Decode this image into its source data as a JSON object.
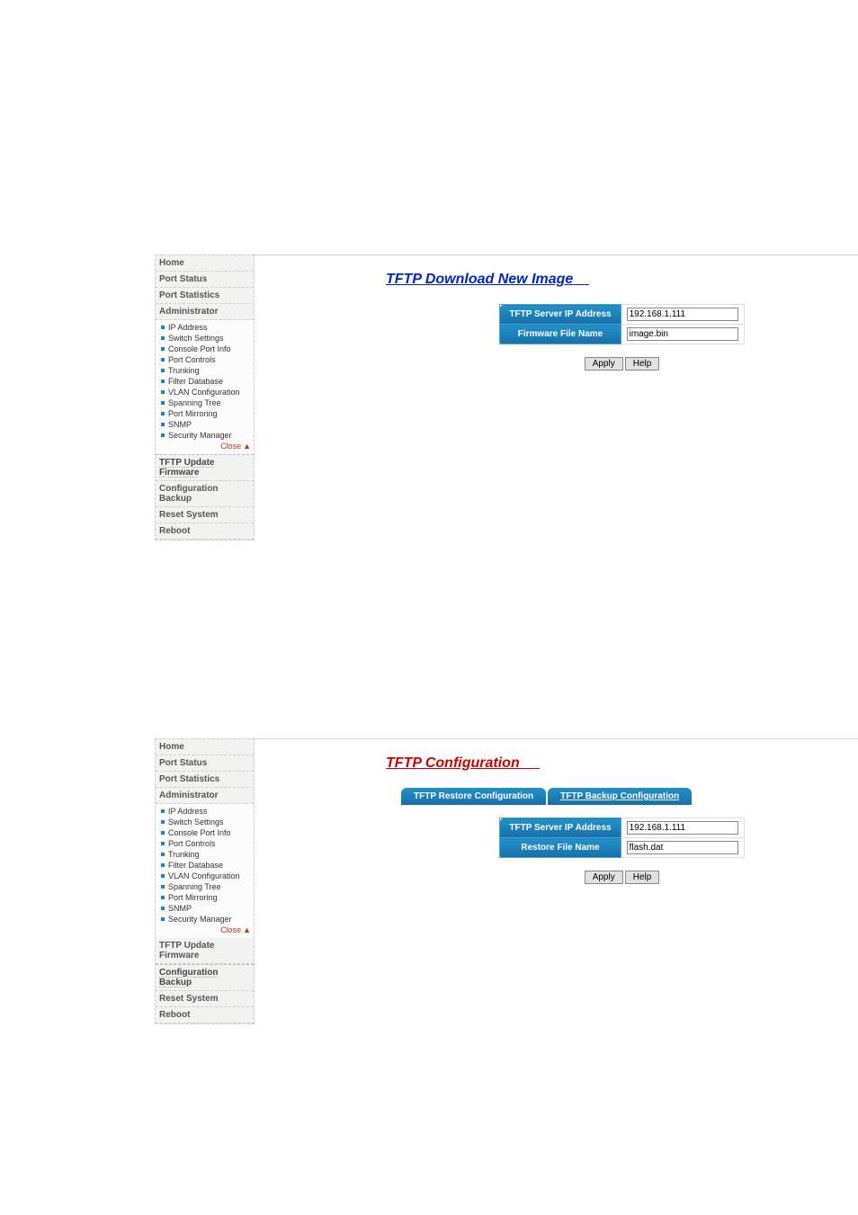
{
  "sidebar": {
    "home": "Home",
    "port_status": "Port Status",
    "port_statistics": "Port Statistics",
    "administrator": "Administrator",
    "admin_items": [
      "IP Address",
      "Switch Settings",
      "Console Port Info",
      "Port Controls",
      "Trunking",
      "Filter Database",
      "VLAN Configuration",
      "Spanning Tree",
      "Port Mirroring",
      "SNMP",
      "Security Manager"
    ],
    "close": "Close",
    "tftp_update": "TFTP Update Firmware",
    "config_backup": "Configuration Backup",
    "reset_system": "Reset System",
    "reboot": "Reboot"
  },
  "page1": {
    "title": "TFTP Download New Image",
    "row1_label": "TFTP Server IP Address",
    "row1_value": "192.168.1.111",
    "row2_label": "Firmware File Name",
    "row2_value": "image.bin",
    "apply": "Apply",
    "help": "Help"
  },
  "page2": {
    "title": "TFTP Configuration",
    "tab1": "TFTP Restore Configuration",
    "tab2": "TFTP Backup Configuration",
    "row1_label": "TFTP Server IP Address",
    "row1_value": "192.168.1.111",
    "row2_label": "Restore File Name",
    "row2_value": "flash.dat",
    "apply": "Apply",
    "help": "Help"
  }
}
